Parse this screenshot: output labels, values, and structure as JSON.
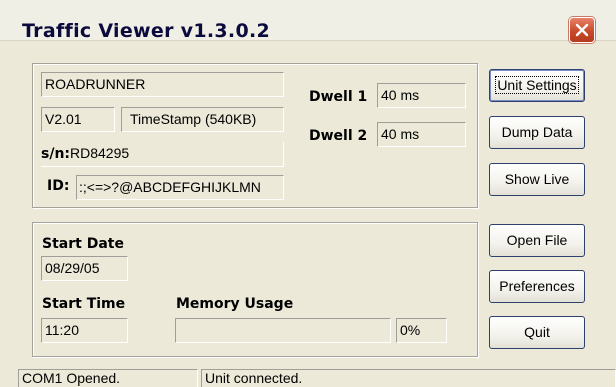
{
  "window": {
    "title": "Traffic Viewer v1.3.0.2",
    "close_icon": "close-x-icon"
  },
  "unit_info": {
    "name": "ROADRUNNER",
    "version": "V2.01",
    "timestamp": "TimeStamp (540KB)",
    "serial_label": "s/n:",
    "serial": "RD84295",
    "id_label": "ID:",
    "id": ":;<=>?@ABCDEFGHIJKLMN",
    "dwell1_label": "Dwell 1",
    "dwell1_value": "40 ms",
    "dwell2_label": "Dwell 2",
    "dwell2_value": "40 ms"
  },
  "session": {
    "start_date_label": "Start Date",
    "start_date": "08/29/05",
    "start_time_label": "Start Time",
    "start_time": "11:20",
    "memory_label": "Memory Usage",
    "memory_percent_text": "0%",
    "memory_fraction": 0
  },
  "buttons": {
    "unit_settings": "Unit Settings",
    "dump_data": "Dump Data",
    "show_live": "Show Live",
    "open_file": "Open File",
    "preferences": "Preferences",
    "quit": "Quit"
  },
  "status": {
    "port": "COM1 Opened.",
    "unit": "Unit connected."
  },
  "colors": {
    "window_bg": "#ece9d8",
    "close_button": "#c94a2a",
    "button_border": "#2f3f6e"
  }
}
